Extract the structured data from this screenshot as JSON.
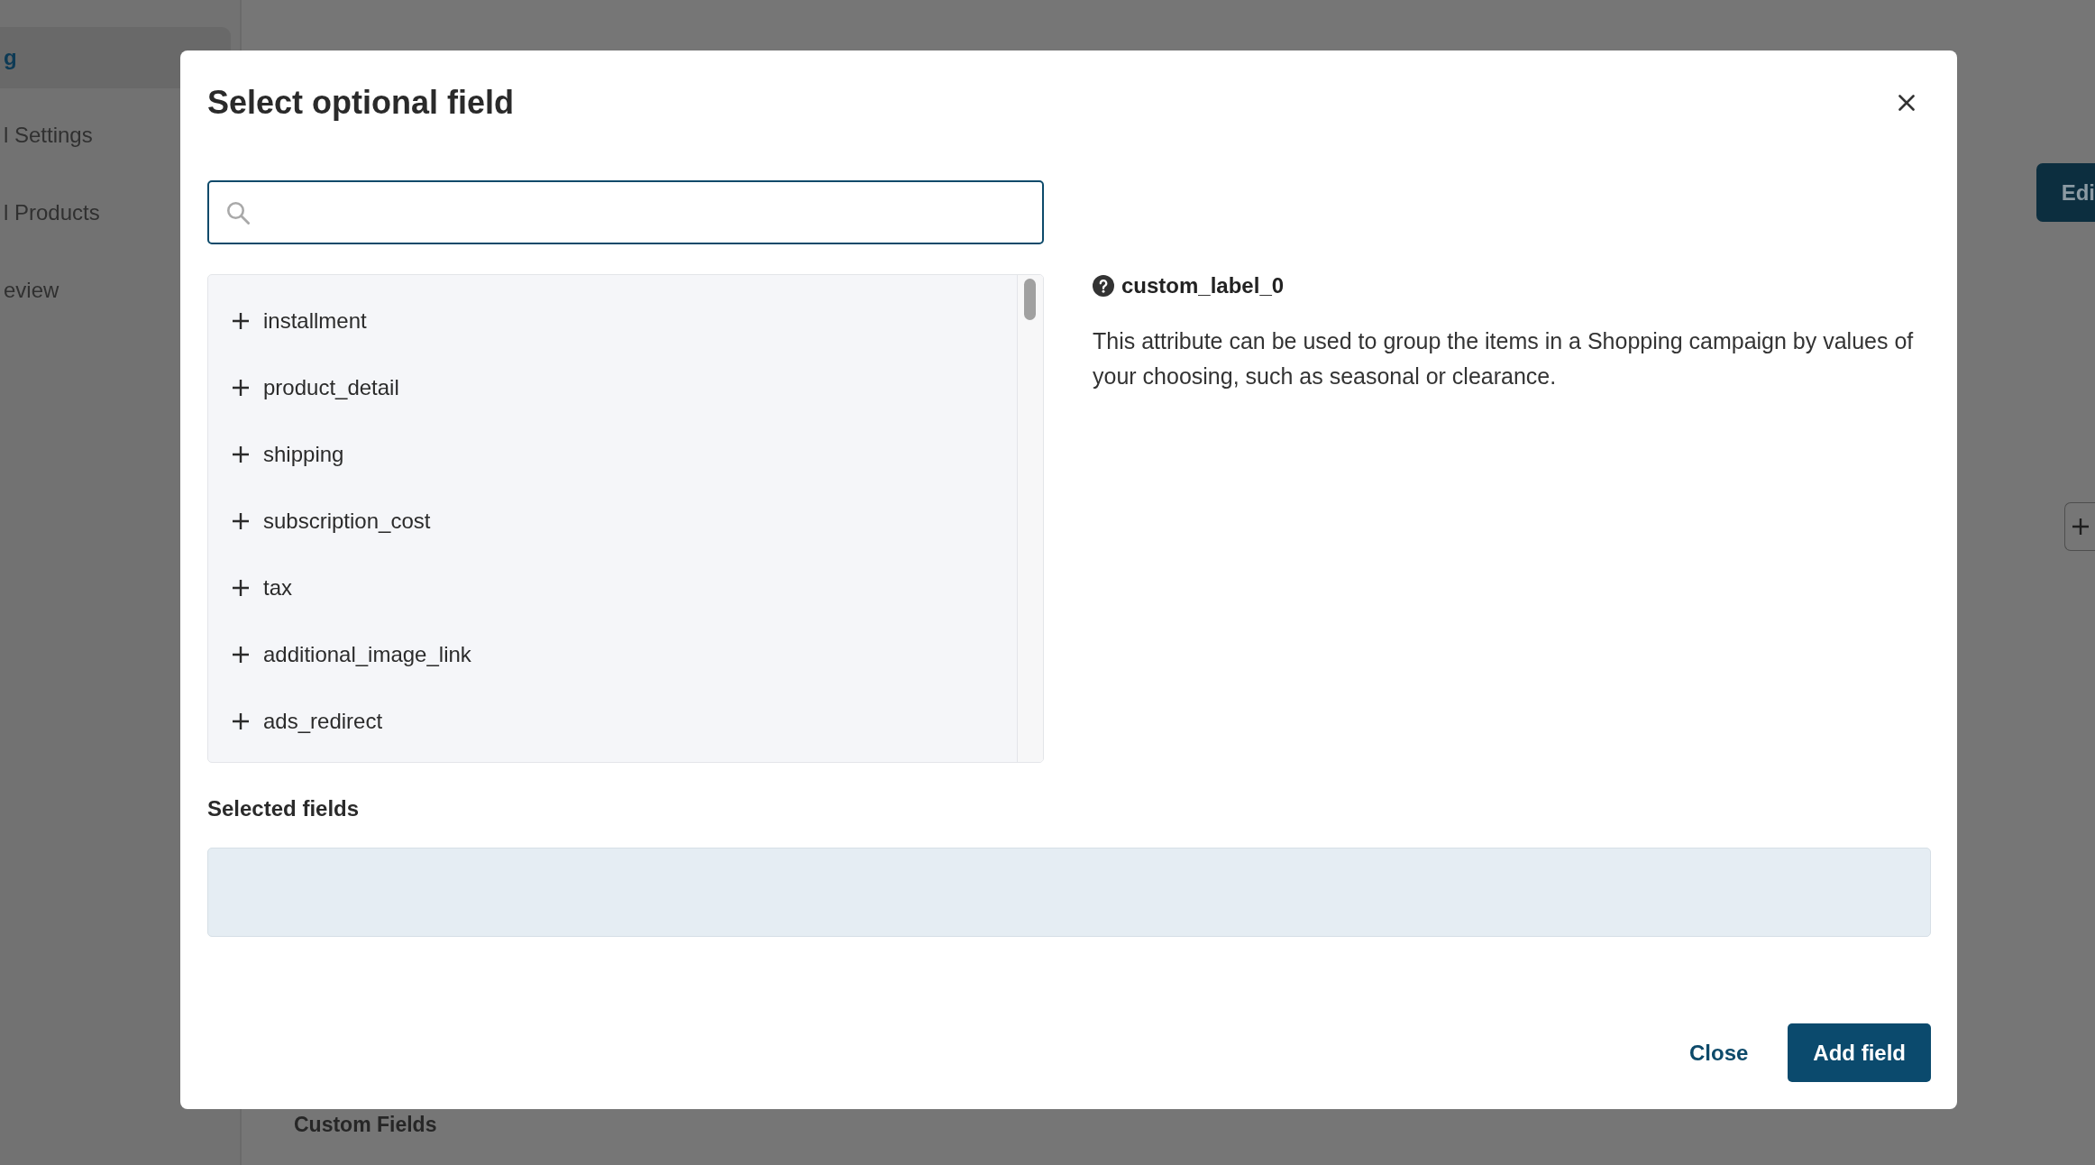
{
  "background_page": {
    "sidebar": {
      "items": [
        {
          "label": "g",
          "selected": true
        },
        {
          "label": "l Settings",
          "selected": false
        },
        {
          "label": "l Products",
          "selected": false
        },
        {
          "label": "eview",
          "selected": false
        }
      ]
    },
    "edit_button": {
      "label": "Edi"
    },
    "section_heading": "Custom Fields"
  },
  "dialog": {
    "title": "Select optional field",
    "search": {
      "focused": true
    },
    "fields": [
      {
        "name": "installment"
      },
      {
        "name": "product_detail"
      },
      {
        "name": "shipping"
      },
      {
        "name": "subscription_cost"
      },
      {
        "name": "tax"
      },
      {
        "name": "additional_image_link"
      },
      {
        "name": "ads_redirect"
      }
    ],
    "detail": {
      "title": "custom_label_0",
      "description": "This attribute can be used to group the items in a Shopping campaign by values of your choosing, such as seasonal or clearance."
    },
    "selected_fields": {
      "label": "Selected fields"
    },
    "buttons": [
      {
        "label": "Close",
        "kind": "link"
      },
      {
        "label": "Add field",
        "kind": "primary"
      }
    ]
  }
}
